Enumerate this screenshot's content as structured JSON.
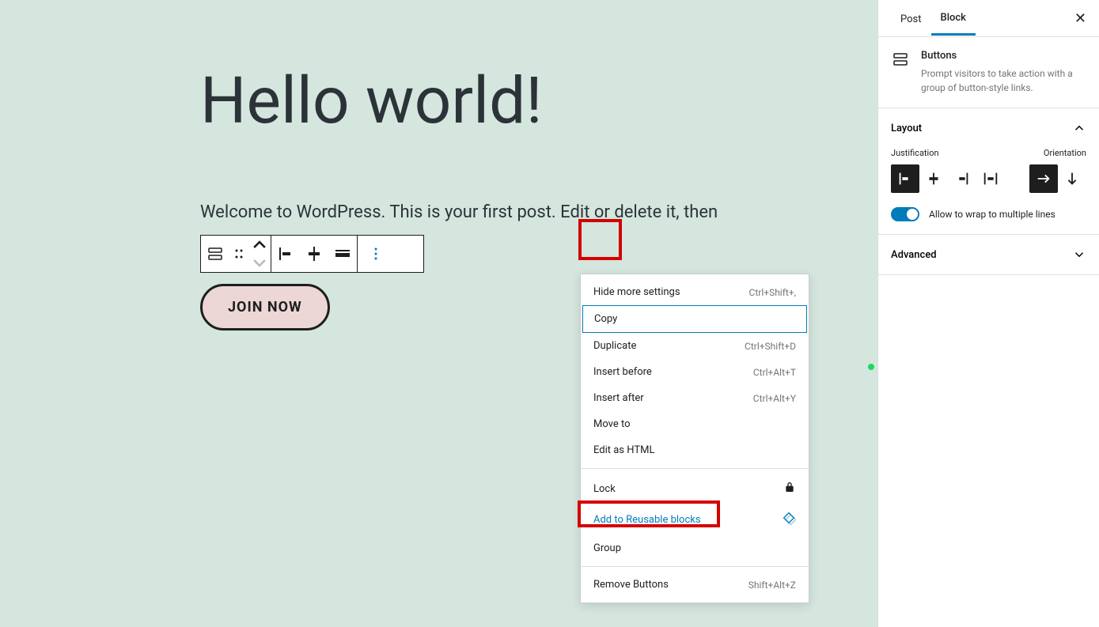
{
  "post": {
    "title": "Hello world!",
    "paragraph": "Welcome to WordPress. This is your first post. Edit or delete it, then",
    "button_label": "JOIN NOW"
  },
  "menu": {
    "hide_settings": "Hide more settings",
    "hide_settings_kbd": "Ctrl+Shift+,",
    "copy": "Copy",
    "duplicate": "Duplicate",
    "duplicate_kbd": "Ctrl+Shift+D",
    "insert_before": "Insert before",
    "insert_before_kbd": "Ctrl+Alt+T",
    "insert_after": "Insert after",
    "insert_after_kbd": "Ctrl+Alt+Y",
    "move_to": "Move to",
    "edit_html": "Edit as HTML",
    "lock": "Lock",
    "reusable": "Add to Reusable blocks",
    "group": "Group",
    "remove": "Remove Buttons",
    "remove_kbd": "Shift+Alt+Z"
  },
  "sidebar": {
    "tab_post": "Post",
    "tab_block": "Block",
    "block_title": "Buttons",
    "block_desc": "Prompt visitors to take action with a group of button-style links.",
    "layout_title": "Layout",
    "justification": "Justification",
    "orientation": "Orientation",
    "wrap_label": "Allow to wrap to multiple lines",
    "advanced_title": "Advanced"
  }
}
